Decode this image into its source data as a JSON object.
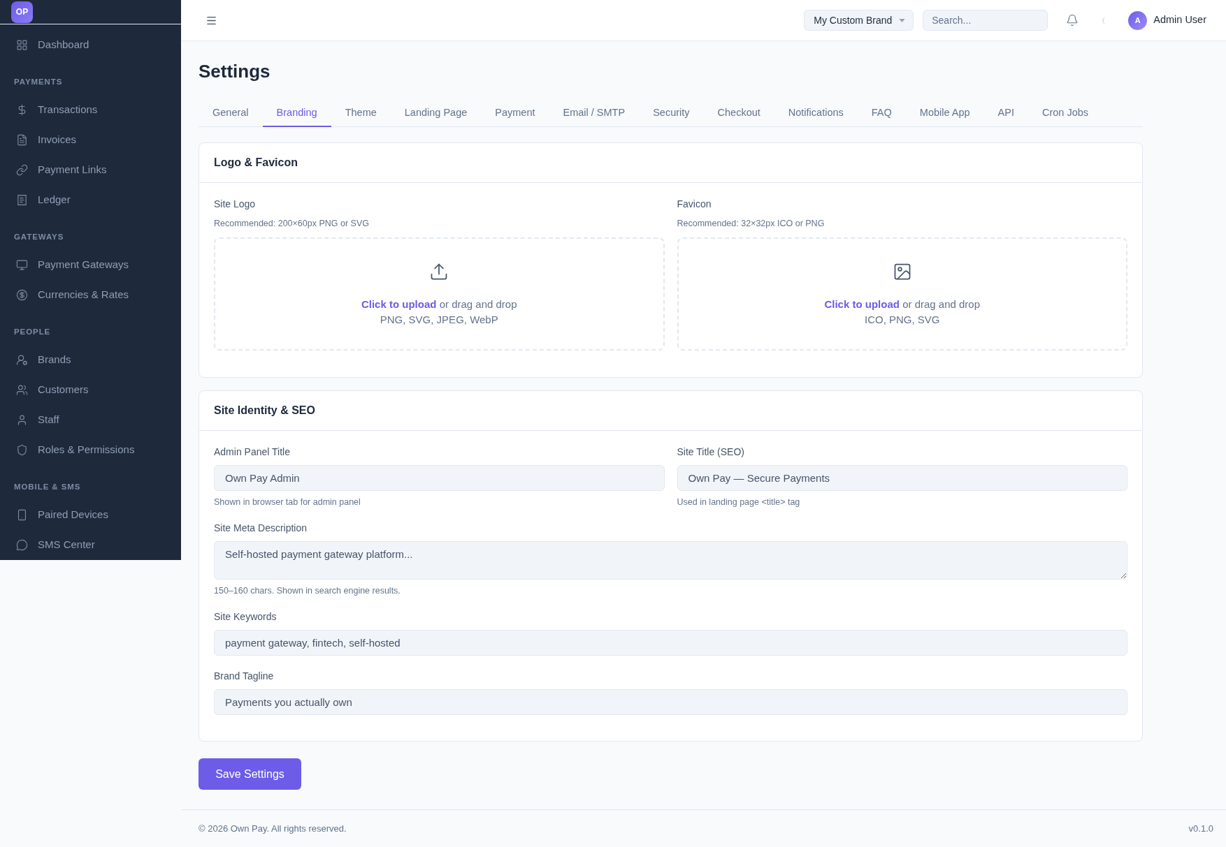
{
  "sidebar": {
    "logo": "OP",
    "sections": [
      {
        "items": [
          {
            "label": "Dashboard"
          }
        ]
      },
      {
        "heading": "PAYMENTS",
        "items": [
          {
            "label": "Transactions"
          },
          {
            "label": "Invoices"
          },
          {
            "label": "Payment Links"
          },
          {
            "label": "Ledger"
          }
        ]
      },
      {
        "heading": "GATEWAYS",
        "items": [
          {
            "label": "Payment Gateways"
          },
          {
            "label": "Currencies & Rates"
          }
        ]
      },
      {
        "heading": "PEOPLE",
        "items": [
          {
            "label": "Brands"
          },
          {
            "label": "Customers"
          },
          {
            "label": "Staff"
          },
          {
            "label": "Roles & Permissions"
          }
        ]
      },
      {
        "heading": "MOBILE & SMS",
        "items": [
          {
            "label": "Paired Devices"
          },
          {
            "label": "SMS Center"
          }
        ]
      }
    ]
  },
  "topbar": {
    "brand_select": {
      "value": "My Custom Brand"
    },
    "search": {
      "placeholder": "Search..."
    },
    "user": {
      "initial": "A",
      "name": "Admin User"
    }
  },
  "page": {
    "title": "Settings"
  },
  "tabs": [
    {
      "label": "General",
      "selected": false
    },
    {
      "label": "Branding",
      "selected": true
    },
    {
      "label": "Theme",
      "selected": false
    },
    {
      "label": "Landing Page",
      "selected": false
    },
    {
      "label": "Payment",
      "selected": false
    },
    {
      "label": "Email / SMTP",
      "selected": false
    },
    {
      "label": "Security",
      "selected": false
    },
    {
      "label": "Checkout",
      "selected": false
    },
    {
      "label": "Notifications",
      "selected": false
    },
    {
      "label": "FAQ",
      "selected": false
    },
    {
      "label": "Mobile App",
      "selected": false
    },
    {
      "label": "API",
      "selected": false
    },
    {
      "label": "Cron Jobs",
      "selected": false
    }
  ],
  "logo_card": {
    "title": "Logo & Favicon",
    "uploads": [
      {
        "label": "Site Logo",
        "hint": "Recommended: 200×60px PNG or SVG",
        "link": "Click to upload",
        "text": "or drag and drop",
        "formats": "PNG, SVG, JPEG, WebP"
      },
      {
        "label": "Favicon",
        "hint": "Recommended: 32×32px ICO or PNG",
        "link": "Click to upload",
        "text": "or drag and drop",
        "formats": "ICO, PNG, SVG"
      }
    ]
  },
  "seo_card": {
    "title": "Site Identity & SEO",
    "rows": [
      {
        "fields": [
          {
            "kind": "input",
            "label": "Admin Panel Title",
            "value": "Own Pay Admin",
            "help": "Shown in browser tab for admin panel"
          },
          {
            "kind": "input",
            "label": "Site Title (SEO)",
            "value": "Own Pay — Secure Payments",
            "help": "Used in landing page <title> tag"
          }
        ]
      },
      {
        "fields": [
          {
            "kind": "textarea",
            "label": "Site Meta Description",
            "value": "Self-hosted payment gateway platform...",
            "help": "150–160 chars. Shown in search engine results."
          }
        ]
      },
      {
        "fields": [
          {
            "kind": "input",
            "label": "Site Keywords",
            "value": "payment gateway, fintech, self-hosted"
          }
        ]
      },
      {
        "fields": [
          {
            "kind": "input",
            "label": "Brand Tagline",
            "value": "Payments you actually own"
          }
        ]
      }
    ]
  },
  "save_button": {
    "label": "Save Settings"
  },
  "footer": {
    "copyright": "© 2026 Own Pay. All rights reserved.",
    "version": "v0.1.0"
  }
}
